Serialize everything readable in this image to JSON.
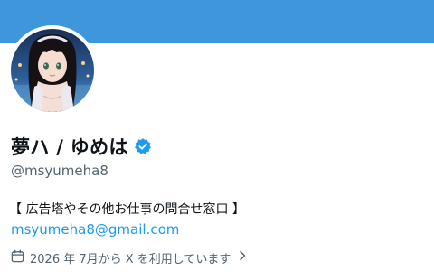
{
  "profile": {
    "display_name": "夢ハ / ゆめは",
    "handle": "@msyumeha8",
    "bio": "【 広告塔やその他お仕事の問合せ窓口 】",
    "email": "msyumeha8@gmail.com",
    "joined": "2026 年 7月から X を利用しています",
    "verified_icon": "verified-badge-icon",
    "calendar_icon": "calendar-icon",
    "chevron_icon": "chevron-right-icon"
  },
  "colors": {
    "banner": "#3e97db",
    "link": "#1d9bf0",
    "verified": "#1d9bf0",
    "secondary_text": "#536471",
    "primary_text": "#0f1419"
  }
}
